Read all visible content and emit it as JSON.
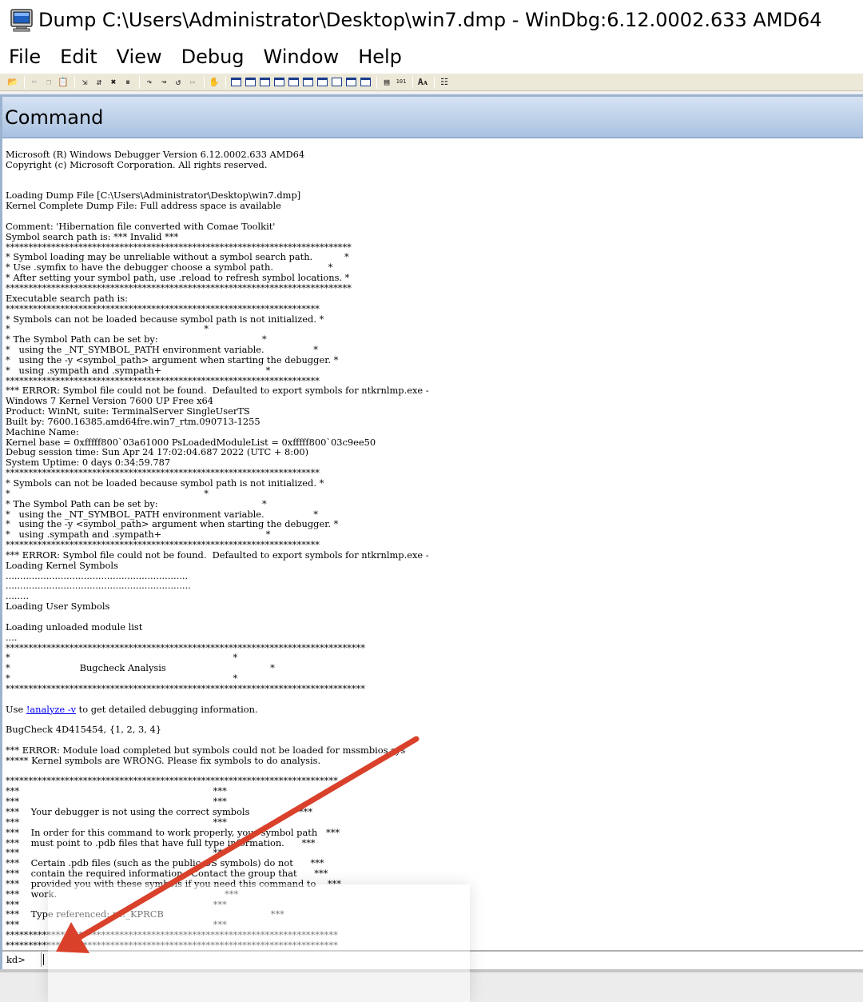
{
  "window": {
    "title": "Dump C:\\Users\\Administrator\\Desktop\\win7.dmp - WinDbg:6.12.0002.633 AMD64",
    "app_icon": "windbg-computer-icon"
  },
  "menu": {
    "items": [
      {
        "label": "File"
      },
      {
        "label": "Edit"
      },
      {
        "label": "View"
      },
      {
        "label": "Debug"
      },
      {
        "label": "Window"
      },
      {
        "label": "Help"
      }
    ]
  },
  "toolbar": {
    "icons": [
      "open-icon",
      "cut-icon",
      "copy-icon",
      "paste-icon",
      "step-into-source-icon",
      "step-over-icon",
      "break-icon",
      "stop-icon",
      "step-into-icon",
      "step-over-icon",
      "step-out-icon",
      "run-to-cursor-icon",
      "hand-icon",
      "command-window-icon",
      "watch-window-icon",
      "locals-window-icon",
      "registers-window-icon",
      "memory-window-icon",
      "call-stack-icon",
      "disassembly-icon",
      "scratch-pad-icon",
      "processes-threads-icon",
      "source-mode-icon",
      "hex-mode-icon",
      "font-icon",
      "options-icon"
    ]
  },
  "command_window": {
    "title": "Command",
    "output_lines": [
      "Microsoft (R) Windows Debugger Version 6.12.0002.633 AMD64",
      "Copyright (c) Microsoft Corporation. All rights reserved.",
      "",
      "",
      "Loading Dump File [C:\\Users\\Administrator\\Desktop\\win7.dmp]",
      "Kernel Complete Dump File: Full address space is available",
      "",
      "Comment: 'Hibernation file converted with Comae Toolkit'",
      "Symbol search path is: *** Invalid ***",
      "****************************************************************************",
      "* Symbol loading may be unreliable without a symbol search path.           *",
      "* Use .symfix to have the debugger choose a symbol path.                   *",
      "* After setting your symbol path, use .reload to refresh symbol locations. *",
      "****************************************************************************",
      "Executable search path is:",
      "*********************************************************************",
      "* Symbols can not be loaded because symbol path is not initialized. *",
      "*                                                                   *",
      "* The Symbol Path can be set by:                                    *",
      "*   using the _NT_SYMBOL_PATH environment variable.                 *",
      "*   using the -y <symbol_path> argument when starting the debugger. *",
      "*   using .sympath and .sympath+                                    *",
      "*********************************************************************",
      "*** ERROR: Symbol file could not be found.  Defaulted to export symbols for ntkrnlmp.exe -",
      "Windows 7 Kernel Version 7600 UP Free x64",
      "Product: WinNt, suite: TerminalServer SingleUserTS",
      "Built by: 7600.16385.amd64fre.win7_rtm.090713-1255",
      "Machine Name:",
      "Kernel base = 0xfffff800`03a61000 PsLoadedModuleList = 0xfffff800`03c9ee50",
      "Debug session time: Sun Apr 24 17:02:04.687 2022 (UTC + 8:00)",
      "System Uptime: 0 days 0:34:59.787",
      "*********************************************************************",
      "* Symbols can not be loaded because symbol path is not initialized. *",
      "*                                                                   *",
      "* The Symbol Path can be set by:                                    *",
      "*   using the _NT_SYMBOL_PATH environment variable.                 *",
      "*   using the -y <symbol_path> argument when starting the debugger. *",
      "*   using .sympath and .sympath+                                    *",
      "*********************************************************************",
      "*** ERROR: Symbol file could not be found.  Defaulted to export symbols for ntkrnlmp.exe -",
      "Loading Kernel Symbols",
      "...............................................................",
      "................................................................",
      "........",
      "Loading User Symbols",
      "",
      "Loading unloaded module list",
      "....",
      "*******************************************************************************",
      "*                                                                             *",
      "*                        Bugcheck Analysis                                    *",
      "*                                                                             *",
      "*******************************************************************************",
      "",
      "Use !analyze -v to get detailed debugging information.",
      "",
      "BugCheck 4D415454, {1, 2, 3, 4}",
      "",
      "*** ERROR: Module load completed but symbols could not be loaded for mssmbios.sys",
      "***** Kernel symbols are WRONG. Please fix symbols to do analysis.",
      "",
      "*************************************************************************",
      "***                                                                   ***",
      "***                                                                   ***",
      "***    Your debugger is not using the correct symbols                 ***",
      "***                                                                   ***",
      "***    In order for this command to work properly, your symbol path   ***",
      "***    must point to .pdb files that have full type information.      ***",
      "***                                                                   ***",
      "***    Certain .pdb files (such as the public OS symbols) do not      ***",
      "***    contain the required information.  Contact the group that      ***",
      "***    provided you with these symbols if you need this command to    ***",
      "***    work.                                                          ***",
      "***                                                                   ***",
      "***    Type referenced: nt!_KPRCB                                     ***",
      "***                                                                   ***",
      "*************************************************************************",
      "*************************************************************************"
    ],
    "analyze_link": "!analyze -v",
    "prompt": "kd>",
    "input_value": ""
  },
  "annotation": {
    "arrow_color": "#d9412b"
  }
}
